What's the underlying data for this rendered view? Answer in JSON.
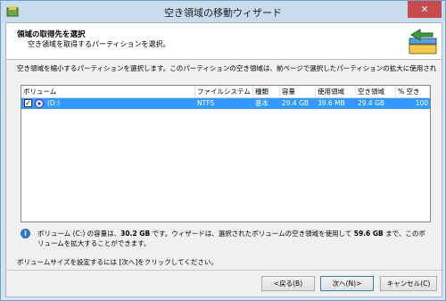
{
  "window": {
    "title": "空き領域の移動ウィザード",
    "close_label": "✕"
  },
  "header": {
    "title": "領域の取得先を選択",
    "subtitle": "空き領域を取得するパーティションを選択。"
  },
  "description": "空き領域を縮小するパーティションを選択します。このパーティションの空き領域は、前ページで選択したパーティションの拡大に使用されます。",
  "table": {
    "columns": [
      "ボリューム",
      "ファイルシステム",
      "種類",
      "容量",
      "使用領域",
      "空き領域",
      "% 空き"
    ],
    "rows": [
      {
        "checked": "✓",
        "volume": "(D:)",
        "fs": "NTFS",
        "type": "基本",
        "capacity": "29.4 GB",
        "used": "39.6 MB",
        "free": "29.4 GB",
        "pct": "100"
      }
    ]
  },
  "info": {
    "p1": "ボリューム (C:) の容量は、",
    "size": "30.2 GB",
    "p2": " です。ウィザードは、選択されたボリュームの空き領域を使用して ",
    "target": "59.6 GB",
    "p3": " まで、このボリュームを拡大することができます。"
  },
  "footer": "ボリュームサイズを設定するには [次へ]をクリックしてください。",
  "buttons": {
    "back": "<戻る(B)",
    "next": "次へ(N)>",
    "cancel": "キャンセル(C)"
  },
  "colors": {
    "selection": "#3399ff",
    "titlebar": "#c9dcee",
    "close": "#c74b4b"
  }
}
